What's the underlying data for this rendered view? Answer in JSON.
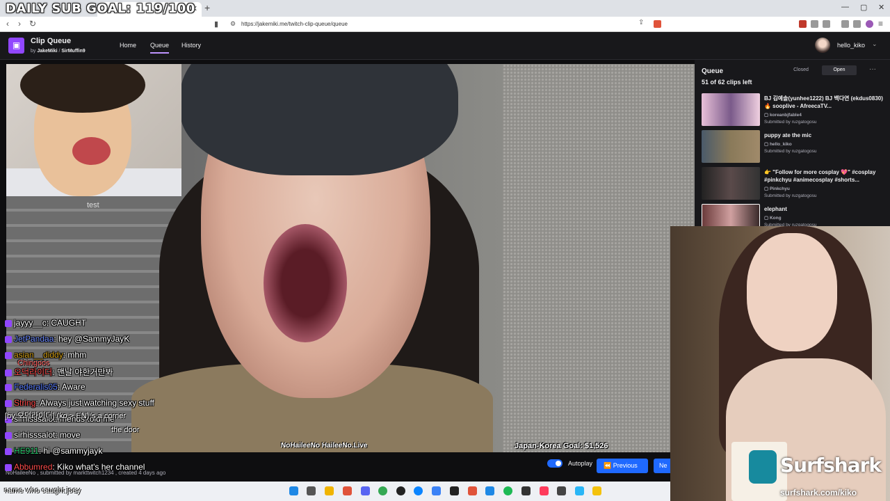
{
  "overlay": {
    "daily_goal": "DAILY SUB GOAL: 119/100"
  },
  "browser": {
    "url": "https://jakemiki.me/twitch-clip-queue/queue"
  },
  "app": {
    "title": "Clip Queue",
    "by_prefix": "by",
    "author1": "JakeMiki",
    "author2": "SirMuffin9",
    "nav": {
      "home": "Home",
      "queue": "Queue",
      "history": "History"
    },
    "user": "hello_kiko"
  },
  "video": {
    "overlay_test": "test",
    "banner": "NoHaileeNo  HaileeNo.Live",
    "goal": "Japan-Korea Goal: $1,526"
  },
  "chat": [
    {
      "user": "jayyy__c",
      "msg": "CAUGHT",
      "color": "#ffffff"
    },
    {
      "user": "JetPandaa",
      "msg": "hey @SammyJayK",
      "color": "#6f8cff"
    },
    {
      "user": "asian__diddy",
      "msg": "mhm",
      "color": "#d4a017"
    },
    {
      "user": "오덕라이더",
      "msg": "맨날 야한거만봐",
      "color": "#ff4d4d"
    },
    {
      "user": "Federalis05",
      "msg": "Aware",
      "color": "#5a7dff"
    },
    {
      "user": "String",
      "msg": "Always just watching sexy stuff",
      "color": "#ff4d4d"
    },
    {
      "user": "sirhisssalot",
      "msg": "friends told me",
      "color": "#ffffff"
    },
    {
      "user": "sirhisssalot",
      "msg": "move",
      "color": "#ffffff"
    },
    {
      "user": "HE911",
      "msg": "hi @sammyjayk",
      "color": "#2ecc71"
    },
    {
      "user": "Abbumred",
      "msg": "Kiko what's her channel",
      "color": "#ff4d4d"
    }
  ],
  "chat_translation": "[by 오덕라이더] (ko > EN)",
  "chat_ghost": {
    "g1": "Chingoos",
    "g2": "'s a corner",
    "g3": "the door"
  },
  "bottom_caption": "name who caught joey",
  "clip_meta": "NoHaileeNo , submitted by markttwitch1234 , created 4 days ago",
  "controls": {
    "autoplay": "Autoplay",
    "previous": "Previous",
    "next": "Ne"
  },
  "queue": {
    "title": "Queue",
    "count": "51 of 62 clips left",
    "closed": "Closed",
    "open": "Open",
    "items": [
      {
        "title": "BJ 김예솔(yunhee1222) BJ 백다연 (ekdus0830) 🔥 sooplive - AfreecaTV...",
        "channel": "koreanbjfable4",
        "submitted": "Submitted by ruzgatogosu"
      },
      {
        "title": "puppy ate the mic",
        "channel": "hello_kiko",
        "submitted": "Submitted by ruzgatogosu"
      },
      {
        "title": "👉 \"Follow for more cosplay 💖\" #cosplay #pinkchyu #animecosplay #shorts...",
        "channel": "Pinkchyu",
        "submitted": "Submitted by ruzgatogosu"
      },
      {
        "title": "elephant",
        "channel": "Kong",
        "submitted": "Submitted by ruzgatogosu"
      }
    ]
  },
  "sponsor": {
    "name": "Surfshark",
    "url": "surfshark.com/kiko"
  }
}
